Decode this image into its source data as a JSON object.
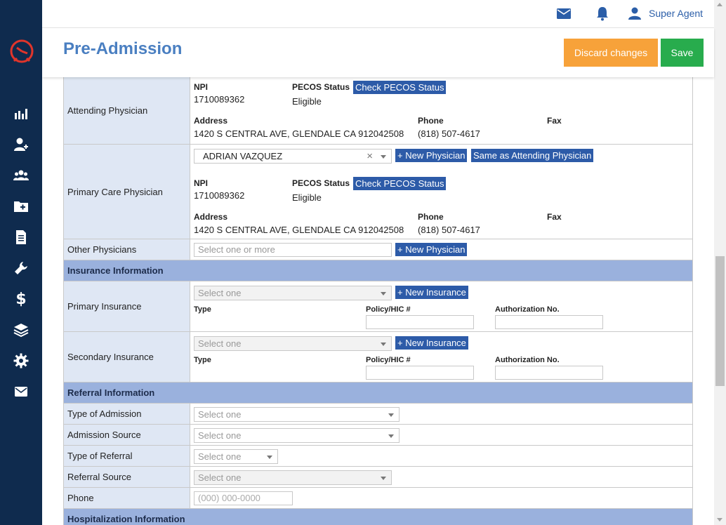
{
  "app": {
    "user_name": "Super Agent"
  },
  "header": {
    "title": "Pre-Admission",
    "discard_label": "Discard changes",
    "save_label": "Save"
  },
  "sidebar": {
    "items": [
      "chart-icon",
      "add-patient-icon",
      "group-icon",
      "add-folder-icon",
      "document-icon",
      "wrench-icon",
      "dollar-icon",
      "layers-icon",
      "gear-icon",
      "mail-icon"
    ]
  },
  "attending": {
    "label": "Attending Physician",
    "npi_label": "NPI",
    "npi": "1710089362",
    "pecos_label": "PECOS Status",
    "pecos_button": "Check PECOS Status",
    "pecos": "Eligible",
    "address_label": "Address",
    "address": "1420 S CENTRAL AVE, GLENDALE CA 912042508",
    "phone_label": "Phone",
    "phone": "(818) 507-4617",
    "fax_label": "Fax"
  },
  "primary_care": {
    "label": "Primary Care Physician",
    "selected": "ADRIAN VAZQUEZ",
    "new_button": "+ New Physician",
    "same_button": "Same as Attending Physician",
    "npi_label": "NPI",
    "npi": "1710089362",
    "pecos_label": "PECOS Status",
    "pecos_button": "Check PECOS Status",
    "pecos": "Eligible",
    "address_label": "Address",
    "address": "1420 S CENTRAL AVE, GLENDALE CA 912042508",
    "phone_label": "Phone",
    "phone": "(818) 507-4617",
    "fax_label": "Fax"
  },
  "other_physicians": {
    "label": "Other Physicians",
    "placeholder": "Select one or more",
    "new_button": "+ New Physician"
  },
  "insurance": {
    "section_title": "Insurance Information",
    "primary": {
      "label": "Primary Insurance",
      "placeholder": "Select one",
      "new_button": "+ New Insurance",
      "type_label": "Type",
      "policy_label": "Policy/HIC #",
      "auth_label": "Authorization No."
    },
    "secondary": {
      "label": "Secondary Insurance",
      "placeholder": "Select one",
      "new_button": "+ New Insurance",
      "type_label": "Type",
      "policy_label": "Policy/HIC #",
      "auth_label": "Authorization No."
    }
  },
  "referral": {
    "section_title": "Referral Information",
    "type_of_admission": {
      "label": "Type of Admission",
      "placeholder": "Select one"
    },
    "admission_source": {
      "label": "Admission Source",
      "placeholder": "Select one"
    },
    "type_of_referral": {
      "label": "Type of Referral",
      "placeholder": "Select one"
    },
    "referral_source": {
      "label": "Referral Source",
      "placeholder": "Select one"
    },
    "phone": {
      "label": "Phone",
      "placeholder": "(000) 000-0000"
    }
  },
  "hospitalization": {
    "section_title": "Hospitalization Information"
  },
  "colors": {
    "sidebar": "#0f2b4e",
    "title": "#4a7fc1",
    "discard": "#f7a23a",
    "save": "#28ac4d",
    "section": "#9ab1dd",
    "label_bg": "#dfe7f4",
    "button": "#2d5ba8"
  }
}
